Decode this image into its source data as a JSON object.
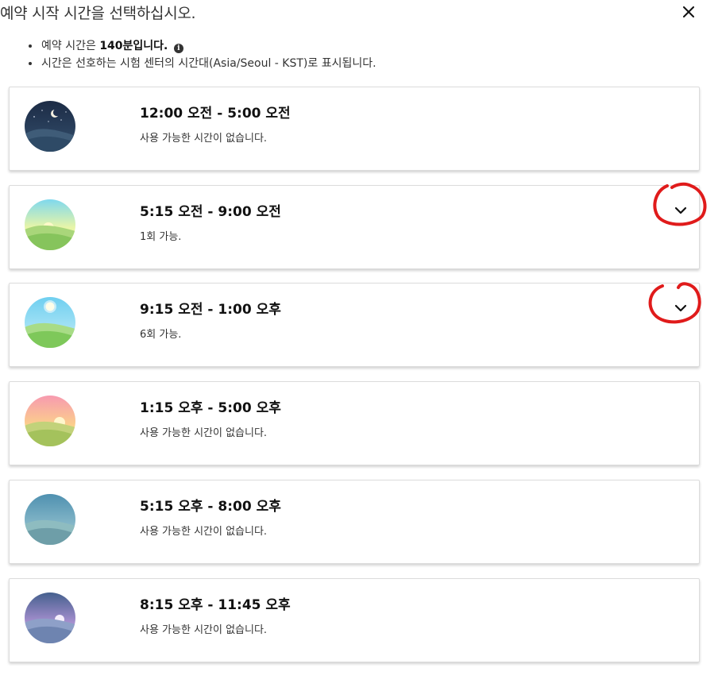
{
  "dialog": {
    "title": "예약 시작 시간을 선택하십시오.",
    "close_icon": "close-icon"
  },
  "info": {
    "duration_prefix": "예약 시간은 ",
    "duration_bold": "140분입니다.",
    "timezone_note": "시간은 선호하는 시험 센터의 시간대(Asia/Seoul - KST)로 표시됩니다."
  },
  "slots": [
    {
      "range": "12:00 오전 - 5:00 오전",
      "status": "사용 가능한 시간이 없습니다.",
      "icon": "night-moon-icon"
    },
    {
      "range": "5:15 오전 - 9:00 오전",
      "status": "1회 가능.",
      "icon": "sunrise-icon",
      "expand_icon": "chevron-down-icon"
    },
    {
      "range": "9:15 오전 - 1:00 오후",
      "status": "6회 가능.",
      "icon": "midday-sun-icon",
      "expand_icon": "chevron-down-icon"
    },
    {
      "range": "1:15 오후 - 5:00 오후",
      "status": "사용 가능한 시간이 없습니다.",
      "icon": "afternoon-sun-icon"
    },
    {
      "range": "5:15 오후 - 8:00 오후",
      "status": "사용 가능한 시간이 없습니다.",
      "icon": "evening-icon"
    },
    {
      "range": "8:15 오후 - 11:45 오후",
      "status": "사용 가능한 시간이 없습니다.",
      "icon": "dusk-icon"
    }
  ],
  "colors": {
    "annotation_red": "#e01b1b",
    "card_border": "#dcdcdc",
    "text_dark": "#111111"
  }
}
